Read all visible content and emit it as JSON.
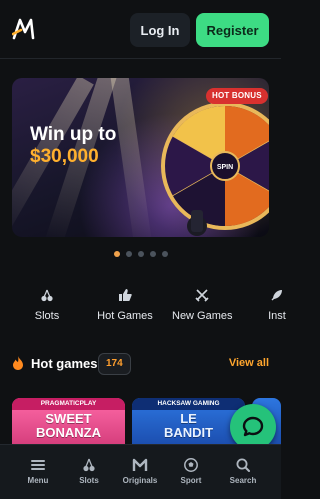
{
  "header": {
    "logo_icon": "script-m-logo-icon",
    "login_label": "Log In",
    "register_label": "Register",
    "accent_color": "#3ddc84"
  },
  "banner": {
    "badge": "HOT BONUS",
    "headline": "Win up to",
    "amount": "$30,000",
    "wheel_center_label": "SPIN"
  },
  "carousel": {
    "total": 5,
    "active_index": 0
  },
  "categories": [
    {
      "label": "Slots",
      "icon": "cherries-icon"
    },
    {
      "label": "Hot Games",
      "icon": "thumbs-up-icon"
    },
    {
      "label": "New Games",
      "icon": "crossed-swords-icon"
    },
    {
      "label": "Inst",
      "icon": "rocket-icon"
    }
  ],
  "hot_games": {
    "title": "Hot games",
    "count": "174",
    "view_all": "View all",
    "icon": "fire-icon"
  },
  "games": [
    {
      "provider": "PRAGMATICPLAY",
      "name_line1": "SWEET",
      "name_line2": "BONANZA"
    },
    {
      "provider": "HACKSAW GAMING",
      "name_line1": "LE",
      "name_line2": "BANDIT"
    },
    {
      "provider": "",
      "name_line1": "",
      "name_line2": ""
    }
  ],
  "chat": {
    "icon": "chat-bubble-icon"
  },
  "bottom_nav": [
    {
      "label": "Menu",
      "icon": "hamburger-menu-icon"
    },
    {
      "label": "Slots",
      "icon": "cherries-icon"
    },
    {
      "label": "Originals",
      "icon": "m-logo-icon"
    },
    {
      "label": "Sport",
      "icon": "soccer-ball-icon"
    },
    {
      "label": "Search",
      "icon": "search-icon"
    }
  ]
}
